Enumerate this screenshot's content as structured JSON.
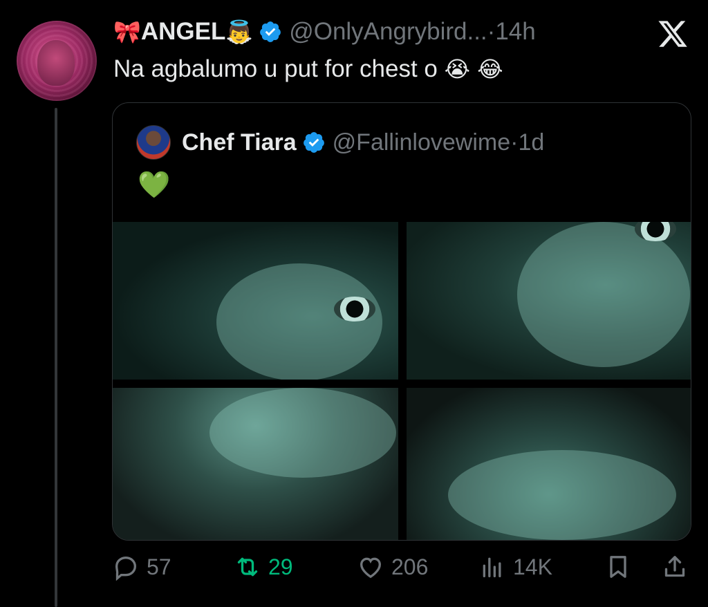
{
  "tweet": {
    "author_prefix_emoji": "🎀",
    "author_name": "ANGEL",
    "author_suffix_emoji": "👼",
    "handle": "@OnlyAngrybird...",
    "separator": " · ",
    "time": "14h",
    "text": "Na agbalumo u put for chest o ",
    "text_emojis": "😭 😂"
  },
  "quote": {
    "author_name": "Chef Tiara",
    "handle": "@Fallinlovewime",
    "separator": " · ",
    "time": "1d",
    "text": "💚"
  },
  "actions": {
    "replies": "57",
    "retweets": "29",
    "likes": "206",
    "views": "14K"
  },
  "colors": {
    "background": "#000000",
    "text": "#e7e9ea",
    "muted": "#71767b",
    "verified": "#1d9bf0",
    "retweet_active": "#00ba7c",
    "border": "#2f3336"
  }
}
